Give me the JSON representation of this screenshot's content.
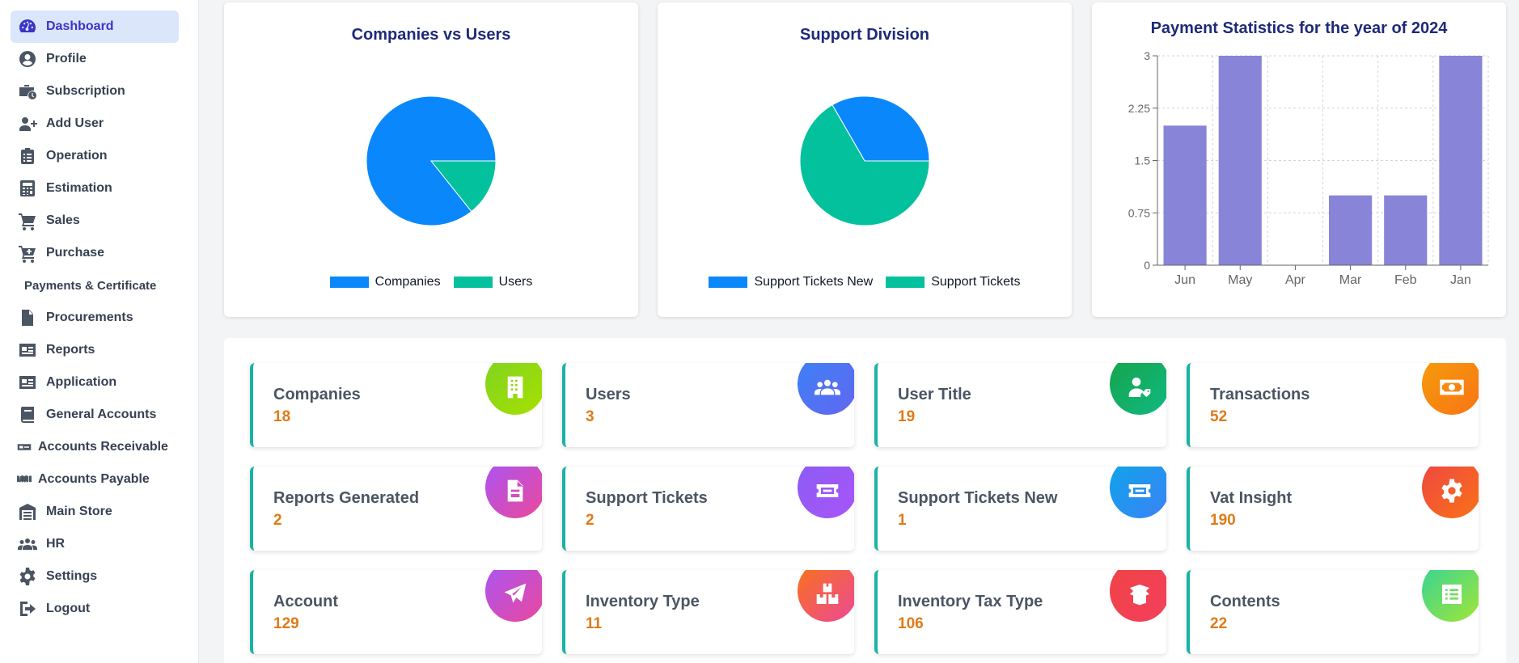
{
  "sidebar": {
    "items": [
      {
        "label": "Dashboard",
        "icon": "dashboard-gauge-icon",
        "active": true
      },
      {
        "label": "Profile",
        "icon": "user-circle-icon"
      },
      {
        "label": "Subscription",
        "icon": "briefcase-clock-icon"
      },
      {
        "label": "Add User",
        "icon": "user-plus-icon"
      },
      {
        "label": "Operation",
        "icon": "clipboard-list-icon"
      },
      {
        "label": "Estimation",
        "icon": "calculator-icon"
      },
      {
        "label": "Sales",
        "icon": "cart-icon"
      },
      {
        "label": "Purchase",
        "icon": "cart-plus-icon"
      },
      {
        "label": "Payments & Certificate",
        "icon": ""
      },
      {
        "label": "Procurements",
        "icon": "file-signature-icon"
      },
      {
        "label": "Reports",
        "icon": "id-card-icon"
      },
      {
        "label": "Application",
        "icon": "id-card-icon"
      },
      {
        "label": "General Accounts",
        "icon": "book-icon"
      },
      {
        "label": "Accounts Receivable",
        "icon": "money-check-icon"
      },
      {
        "label": "Accounts Payable",
        "icon": "handshake-icon"
      },
      {
        "label": "Main Store",
        "icon": "warehouse-icon"
      },
      {
        "label": "HR",
        "icon": "users-icon"
      },
      {
        "label": "Settings",
        "icon": "gear-icon"
      },
      {
        "label": "Logout",
        "icon": "logout-icon"
      }
    ]
  },
  "charts": {
    "companies_users": {
      "title": "Companies vs Users",
      "legend": [
        "Companies",
        "Users"
      ],
      "colors": [
        "#0a88fb",
        "#04c19d"
      ]
    },
    "support_division": {
      "title": "Support Division",
      "legend": [
        "Support Tickets New",
        "Support Tickets"
      ],
      "colors": [
        "#0a88fb",
        "#04c19d"
      ]
    },
    "payment_stats": {
      "title": "Payment Statistics for the year of 2024",
      "color": "#8884d8"
    }
  },
  "chart_data": [
    {
      "type": "pie",
      "title": "Companies vs Users",
      "categories": [
        "Companies",
        "Users"
      ],
      "values": [
        18,
        3
      ]
    },
    {
      "type": "pie",
      "title": "Support Division",
      "categories": [
        "Support Tickets New",
        "Support Tickets"
      ],
      "values": [
        1,
        2
      ]
    },
    {
      "type": "bar",
      "title": "Payment Statistics for the year of 2024",
      "categories": [
        "Jun",
        "May",
        "Apr",
        "Mar",
        "Feb",
        "Jan"
      ],
      "values": [
        2,
        3,
        0,
        1,
        1,
        3
      ],
      "yticks": [
        "0",
        "0.75",
        "1.5",
        "2.25",
        "3"
      ],
      "ylim": [
        0,
        3
      ],
      "grid": true,
      "xlabel": "",
      "ylabel": ""
    }
  ],
  "stats": [
    {
      "title": "Companies",
      "value": "18",
      "icon": "building-icon",
      "gradient": [
        "#7ed321",
        "#a8e000"
      ]
    },
    {
      "title": "Users",
      "value": "3",
      "icon": "users-group-icon",
      "gradient": [
        "#3b82f6",
        "#6366f1"
      ]
    },
    {
      "title": "User Title",
      "value": "19",
      "icon": "user-tag-icon",
      "gradient": [
        "#16a34a",
        "#10b981"
      ]
    },
    {
      "title": "Transactions",
      "value": "52",
      "icon": "money-bill-icon",
      "gradient": [
        "#f59e0b",
        "#f97316"
      ]
    },
    {
      "title": "Reports Generated",
      "value": "2",
      "icon": "file-report-icon",
      "gradient": [
        "#a855f7",
        "#ec4899"
      ]
    },
    {
      "title": "Support Tickets",
      "value": "2",
      "icon": "ticket-icon",
      "gradient": [
        "#8b5cf6",
        "#a855f7"
      ]
    },
    {
      "title": "Support Tickets New",
      "value": "1",
      "icon": "ticket-icon",
      "gradient": [
        "#0ea5e9",
        "#3b82f6"
      ]
    },
    {
      "title": "Vat Insight",
      "value": "190",
      "icon": "gear-icon",
      "gradient": [
        "#ef4444",
        "#f97316"
      ]
    },
    {
      "title": "Account",
      "value": "129",
      "icon": "paper-plane-icon",
      "gradient": [
        "#a855f7",
        "#ec4899"
      ]
    },
    {
      "title": "Inventory Type",
      "value": "11",
      "icon": "boxes-icon",
      "gradient": [
        "#f97316",
        "#ec4899"
      ]
    },
    {
      "title": "Inventory Tax Type",
      "value": "106",
      "icon": "box-open-icon",
      "gradient": [
        "#ef4444",
        "#f43f5e"
      ]
    },
    {
      "title": "Contents",
      "value": "22",
      "icon": "list-icon",
      "gradient": [
        "#34d399",
        "#a3e635"
      ]
    }
  ]
}
